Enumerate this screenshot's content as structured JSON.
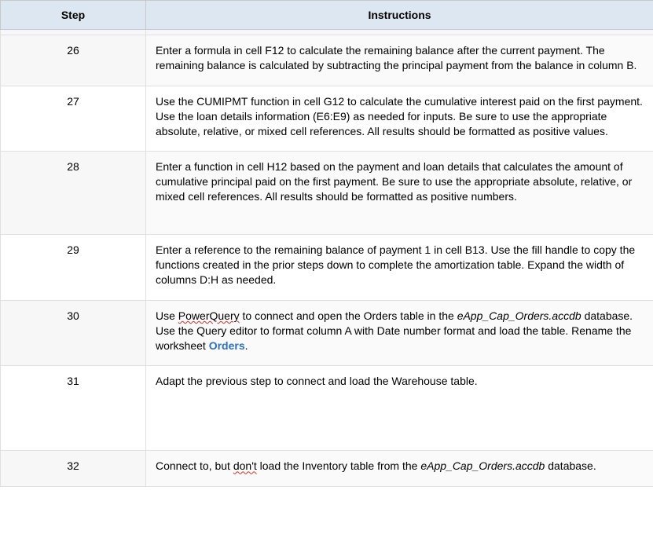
{
  "headers": {
    "step": "Step",
    "instructions": "Instructions"
  },
  "rows": [
    {
      "step": "26",
      "seg1": "Enter a formula in cell F12 to calculate the remaining balance after the current payment. The remaining balance is calculated by subtracting the principal payment from the balance in column B."
    },
    {
      "step": "27",
      "seg1": "Use the CUMIPMT function in cell G12 to calculate the cumulative interest paid on the first payment. Use the loan details information (E6:E9) as needed for inputs. Be sure to use the appropriate absolute, relative, or mixed cell references. All results should be formatted as positive values."
    },
    {
      "step": "28",
      "seg1": "Enter a function in cell H12 based on the payment and loan details that calculates the amount of cumulative principal paid on the first payment. Be sure to use the appropriate absolute, relative, or mixed cell references. All results should be formatted as positive numbers."
    },
    {
      "step": "29",
      "seg1": "Enter a reference to the remaining balance of payment 1 in cell B13. Use the fill handle to copy the functions created in the prior steps down to complete the amortization table. Expand the width of columns D:H as needed."
    },
    {
      "step": "30",
      "seg1": "Use ",
      "sq1": "PowerQuery",
      "seg2": " to connect and open the Orders table in the ",
      "it1": "eApp_Cap_Orders.accdb",
      "seg3": " database. Use the Query editor to format column A with Date number format and load the table. Rename the worksheet ",
      "link1": "Orders",
      "seg4": "."
    },
    {
      "step": "31",
      "seg1": "Adapt the previous step to connect and load the Warehouse table."
    },
    {
      "step": "32",
      "seg1": "Connect to, but ",
      "sq1": "don't",
      "seg2": " load the Inventory table from the ",
      "it1": "eApp_Cap_Orders.accdb",
      "seg3": " database."
    }
  ]
}
